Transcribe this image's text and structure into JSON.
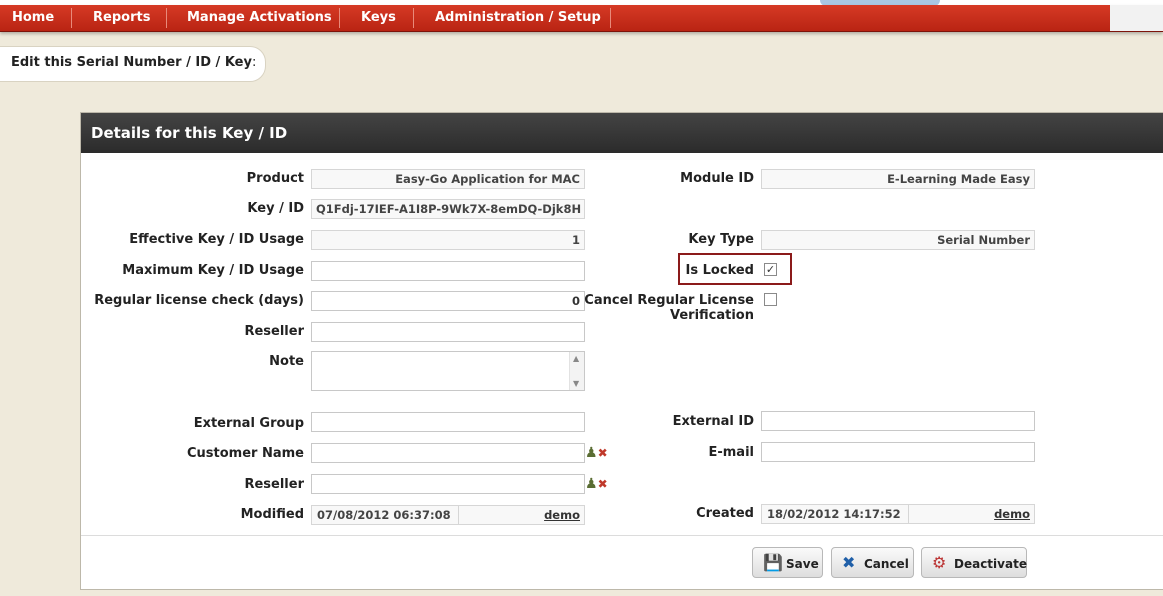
{
  "nav": {
    "items": [
      "Home",
      "Reports",
      "Manage Activations",
      "Keys",
      "Administration / Setup"
    ]
  },
  "page": {
    "title_bold": "Edit this",
    "title_rest": " Serial Number / ID / Key",
    "title_colon": ":"
  },
  "panel": {
    "title": "Details for this Key / ID"
  },
  "form": {
    "product_label": "Product",
    "product_value": "Easy-Go Application for MAC",
    "key_label": "Key / ID",
    "key_value": "Q1Fdj-17IEF-A1I8P-9Wk7X-8emDQ-Djk8H",
    "effective_usage_label": "Effective Key / ID Usage",
    "effective_usage_value": "1",
    "max_usage_label": "Maximum Key / ID Usage",
    "max_usage_value": "",
    "license_check_label": "Regular license check (days)",
    "license_check_value": "0",
    "reseller_label": "Reseller",
    "reseller_value": "",
    "note_label": "Note",
    "note_value": "",
    "external_group_label": "External Group",
    "external_group_value": "",
    "customer_name_label": "Customer Name",
    "customer_name_value": "",
    "reseller2_label": "Reseller",
    "reseller2_value": "",
    "modified_label": "Modified",
    "modified_date": "07/08/2012 06:37:08",
    "modified_user": "demo",
    "module_id_label": "Module ID",
    "module_id_value": "E-Learning Made Easy",
    "key_type_label": "Key Type",
    "key_type_value": "Serial Number",
    "is_locked_label": "Is Locked",
    "is_locked_checked": true,
    "cancel_check_label_1": "Cancel Regular License",
    "cancel_check_label_2": "Verification",
    "cancel_check_checked": false,
    "external_id_label": "External ID",
    "external_id_value": "",
    "email_label": "E-mail",
    "email_value": "",
    "created_label": "Created",
    "created_date": "18/02/2012 14:17:52",
    "created_user": "demo"
  },
  "buttons": {
    "save": "Save",
    "cancel": "Cancel",
    "deactivate": "Deactivate"
  },
  "icons": {
    "checkmark": "✓",
    "user_lookup": "user-search-icon",
    "user_clear": "user-clear-icon"
  },
  "colors": {
    "nav_red": "#c42d18",
    "header_dark": "#333333",
    "highlight_border": "#8b1a1a",
    "page_bg": "#efeadb"
  }
}
